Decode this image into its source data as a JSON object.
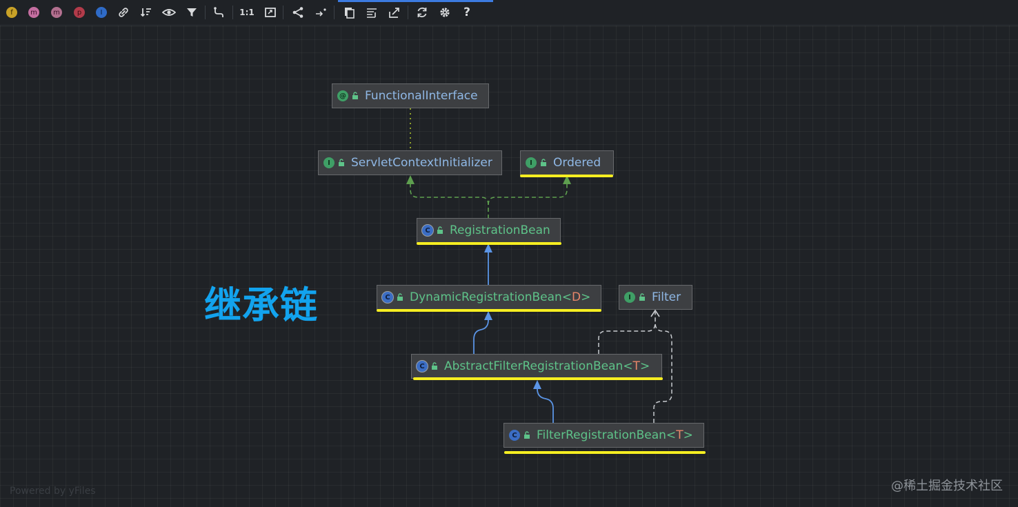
{
  "toolbar": {
    "zoom_label": "1:1",
    "help_label": "?",
    "buttons": [
      {
        "name": "fields-filter",
        "glyph": "f",
        "color": "#c9a227"
      },
      {
        "name": "methods-filter",
        "glyph": "m",
        "color": "#c46ea0"
      },
      {
        "name": "methods-alt-filter",
        "glyph": "m",
        "color": "#b2708f"
      },
      {
        "name": "properties-filter",
        "glyph": "p",
        "color": "#b23b4a"
      },
      {
        "name": "inner-filter",
        "glyph": "I",
        "color": "#2f6bc7"
      }
    ]
  },
  "diagram": {
    "title": "继承链",
    "nodes": [
      {
        "id": "functional-interface",
        "label": "FunctionalInterface",
        "type_param": "",
        "kind": "annotation",
        "badge": "@"
      },
      {
        "id": "servlet-context-initializer",
        "label": "ServletContextInitializer",
        "type_param": "",
        "kind": "interface",
        "badge": "I"
      },
      {
        "id": "ordered",
        "label": "Ordered",
        "type_param": "",
        "kind": "interface",
        "badge": "I"
      },
      {
        "id": "registration-bean",
        "label": "RegistrationBean",
        "type_param": "",
        "kind": "abstract-class",
        "badge": "C"
      },
      {
        "id": "dynamic-registration-bean",
        "label": "DynamicRegistrationBean<",
        "type_param": "D",
        "kind": "abstract-class",
        "badge": "C"
      },
      {
        "id": "filter",
        "label": "Filter",
        "type_param": "",
        "kind": "interface",
        "badge": "I"
      },
      {
        "id": "abstract-filter-registration-bean",
        "label": "AbstractFilterRegistrationBean<",
        "type_param": "T",
        "kind": "abstract-class",
        "badge": "C"
      },
      {
        "id": "filter-registration-bean",
        "label": "FilterRegistrationBean<",
        "type_param": "T",
        "kind": "class",
        "badge": "C"
      }
    ],
    "closing_bracket": ">",
    "edges": [
      {
        "from": "servlet-context-initializer",
        "to": "functional-interface",
        "kind": "annotated-by"
      },
      {
        "from": "registration-bean",
        "to": "servlet-context-initializer",
        "kind": "implements"
      },
      {
        "from": "registration-bean",
        "to": "ordered",
        "kind": "implements"
      },
      {
        "from": "dynamic-registration-bean",
        "to": "registration-bean",
        "kind": "extends"
      },
      {
        "from": "abstract-filter-registration-bean",
        "to": "dynamic-registration-bean",
        "kind": "extends"
      },
      {
        "from": "filter-registration-bean",
        "to": "abstract-filter-registration-bean",
        "kind": "extends"
      },
      {
        "from": "abstract-filter-registration-bean",
        "to": "filter",
        "kind": "implements"
      },
      {
        "from": "filter-registration-bean",
        "to": "filter",
        "kind": "implements"
      }
    ],
    "highlighted": [
      "ordered",
      "registration-bean",
      "dynamic-registration-bean",
      "abstract-filter-registration-bean",
      "filter-registration-bean"
    ],
    "colors": {
      "highlight": "#f6ee21",
      "title": "#12a3ee",
      "extends_edge": "#5b95e6",
      "implements_edge": "#5e9f4f",
      "annotation_edge": "#8fa22a",
      "type_param": "#e8876a"
    }
  },
  "footer": {
    "powered_by": "Powered by yFiles",
    "watermark": "@稀土掘金技术社区"
  }
}
